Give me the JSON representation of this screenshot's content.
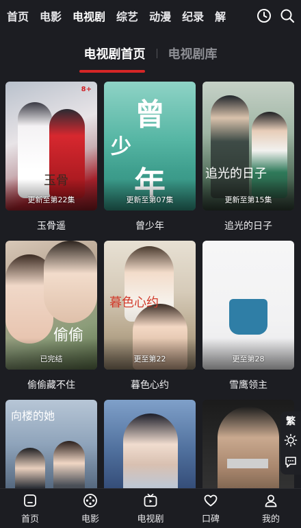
{
  "top_nav": {
    "tabs": [
      {
        "label": "首页"
      },
      {
        "label": "电影"
      },
      {
        "label": "电视剧"
      },
      {
        "label": "综艺"
      },
      {
        "label": "动漫"
      },
      {
        "label": "纪录"
      },
      {
        "label": "解"
      }
    ],
    "active_tab": "电视剧",
    "icons": [
      "history-icon",
      "search-icon"
    ],
    "accent_color": "#e8512c"
  },
  "sub_header": {
    "tabs": [
      {
        "label": "电视剧首页"
      },
      {
        "label": "电视剧库"
      }
    ],
    "active_tab": "电视剧首页",
    "underline_color": "#d62626"
  },
  "cards": [
    {
      "title": "玉骨遥",
      "badge": "更新至第22集",
      "poster_text": "玉骨",
      "corner": "8+"
    },
    {
      "title": "曾少年",
      "badge": "更新至第07集",
      "poster_text_1": "曾",
      "poster_text_2": "少",
      "poster_text_3": "年"
    },
    {
      "title": "追光的日子",
      "badge": "更新至第15集",
      "poster_text": "追光的日子"
    },
    {
      "title": "偷偷藏不住",
      "badge": "已完结",
      "poster_text": "偷偷"
    },
    {
      "title": "暮色心约",
      "badge": "更至第22",
      "poster_text": "暮色心约"
    },
    {
      "title": "雪鹰领主",
      "badge": "更至第28"
    },
    {
      "title": "",
      "badge": "",
      "poster_text": "向楼的她"
    },
    {
      "title": "",
      "badge": ""
    },
    {
      "title": "",
      "badge": ""
    }
  ],
  "side_tools": {
    "traditional_label": "繁",
    "icons": [
      "brightness-icon",
      "comment-icon"
    ]
  },
  "bottom_nav": {
    "items": [
      {
        "label": "首页",
        "icon": "home-icon"
      },
      {
        "label": "电影",
        "icon": "film-reel-icon"
      },
      {
        "label": "电视剧",
        "icon": "tv-icon"
      },
      {
        "label": "口碑",
        "icon": "heart-icon"
      },
      {
        "label": "我的",
        "icon": "user-icon"
      }
    ]
  },
  "colors": {
    "background": "#1c1d22",
    "text": "#ffffff",
    "muted_text": "#8e8f95"
  }
}
